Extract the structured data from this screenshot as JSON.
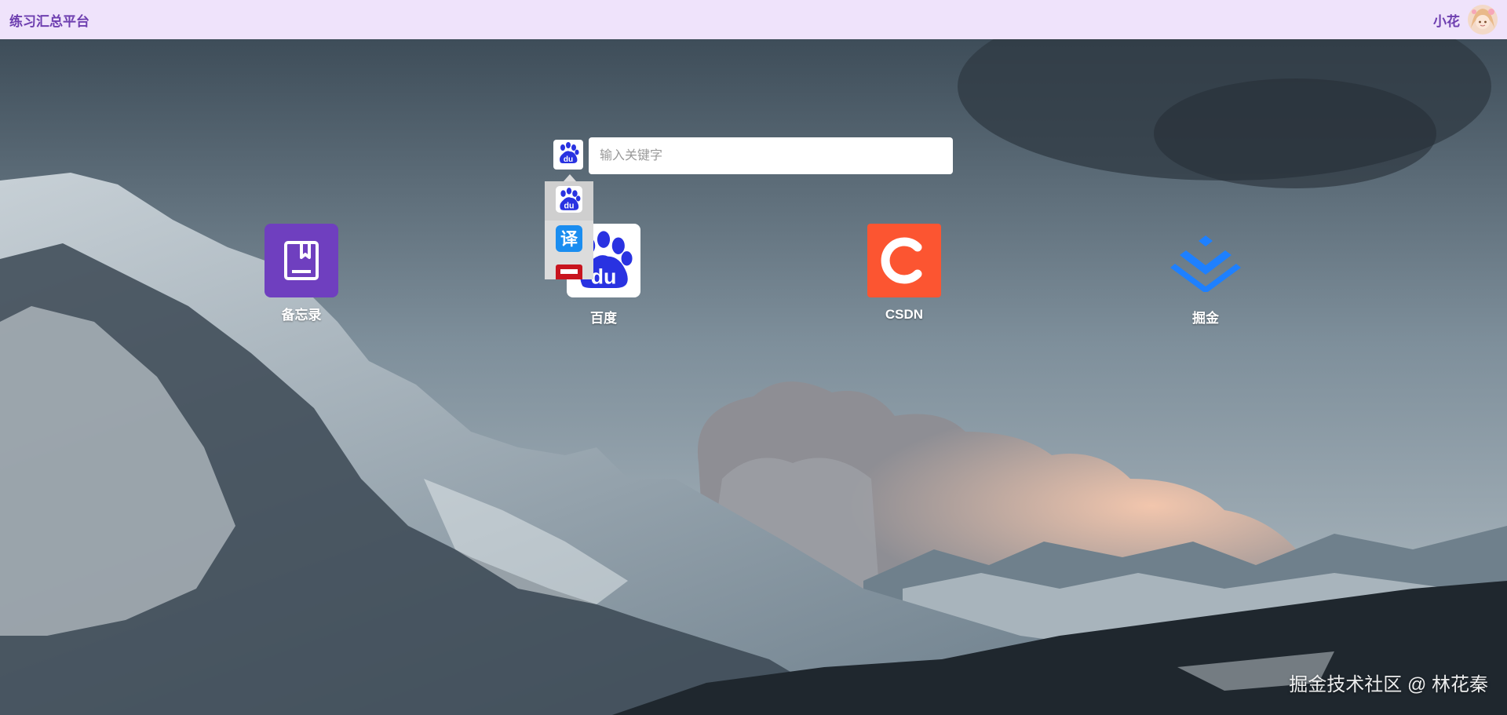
{
  "header": {
    "title": "练习汇总平台",
    "user_name": "小花"
  },
  "search": {
    "placeholder": "输入关键字",
    "value": "",
    "engine_options": [
      {
        "name": "baidu-icon",
        "glyph": "du"
      },
      {
        "name": "translate-icon",
        "glyph": "译"
      },
      {
        "name": "partial-icon",
        "glyph": ""
      }
    ]
  },
  "shortcuts": [
    {
      "label": "备忘录",
      "icon": "notebook-icon",
      "color": "#6f3fbf"
    },
    {
      "label": "百度",
      "icon": "baidu-icon",
      "color": "#ffffff"
    },
    {
      "label": "CSDN",
      "icon": "csdn-icon",
      "color": "#fc5531"
    },
    {
      "label": "掘金",
      "icon": "juejin-icon",
      "color": "#1e80ff"
    }
  ],
  "watermark": "掘金技术社区 @ 林花秦",
  "colors": {
    "header_bg": "#efe3fb",
    "accent": "#6e3fb0",
    "baidu_blue": "#2932e1"
  }
}
